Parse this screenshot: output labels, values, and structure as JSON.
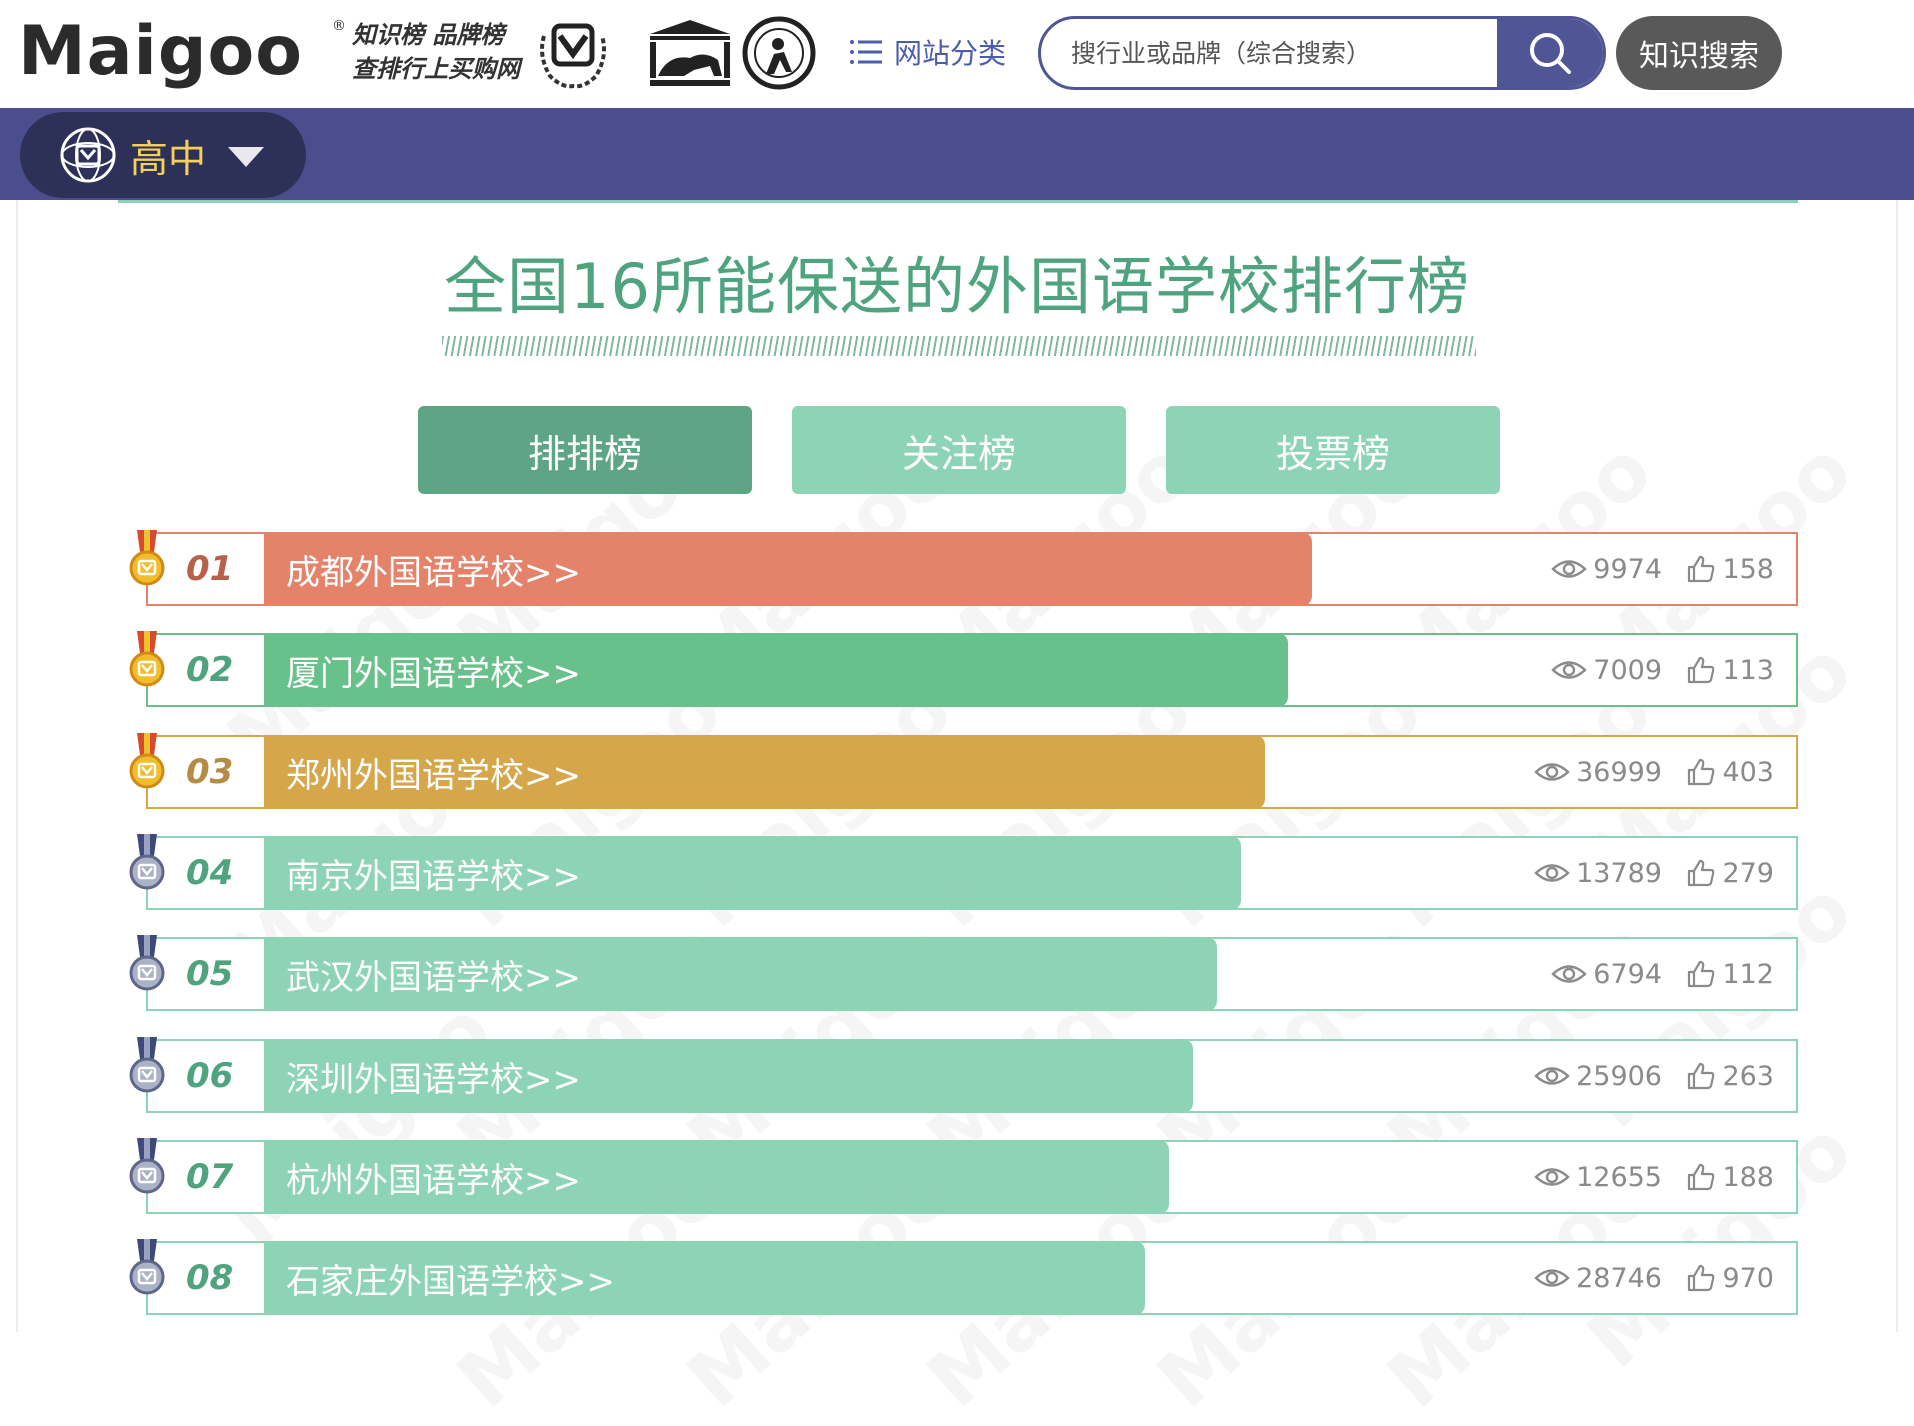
{
  "header": {
    "logo_text": "Maigoo",
    "logo_reg": "®",
    "slogan_line1": "知识榜 品牌榜",
    "slogan_line2": "查排行上买购网",
    "nav_category_label": "网站分类",
    "search_placeholder": "搜行业或品牌（综合搜索）",
    "knowledge_search_label": "知识搜索"
  },
  "category_bar": {
    "label": "高中"
  },
  "page": {
    "title": "全国16所能保送的外国语学校排行榜",
    "watermark_text": "Maigoo"
  },
  "tabs": [
    {
      "label": "排排榜",
      "active": true
    },
    {
      "label": "关注榜",
      "active": false
    },
    {
      "label": "投票榜",
      "active": false
    }
  ],
  "rows": [
    {
      "rank": "01",
      "name": "成都外国语学校>>",
      "views": "9974",
      "likes": "158",
      "color": "#e5826a",
      "rank_color": "#b8614a",
      "medal": "gold"
    },
    {
      "rank": "02",
      "name": "厦门外国语学校>>",
      "views": "7009",
      "likes": "113",
      "color": "#68c08a",
      "rank_color": "#4fa47f",
      "medal": "gold"
    },
    {
      "rank": "03",
      "name": "郑州外国语学校>>",
      "views": "36999",
      "likes": "403",
      "color": "#d5a64a",
      "rank_color": "#b48c46",
      "medal": "gold"
    },
    {
      "rank": "04",
      "name": "南京外国语学校>>",
      "views": "13789",
      "likes": "279",
      "color": "#8dd3b5",
      "rank_color": "#4fa47f",
      "medal": "silver"
    },
    {
      "rank": "05",
      "name": "武汉外国语学校>>",
      "views": "6794",
      "likes": "112",
      "color": "#8dd3b5",
      "rank_color": "#4fa47f",
      "medal": "silver"
    },
    {
      "rank": "06",
      "name": "深圳外国语学校>>",
      "views": "25906",
      "likes": "263",
      "color": "#8dd3b5",
      "rank_color": "#4fa47f",
      "medal": "silver"
    },
    {
      "rank": "07",
      "name": "杭州外国语学校>>",
      "views": "12655",
      "likes": "188",
      "color": "#8dd3b5",
      "rank_color": "#4fa47f",
      "medal": "silver"
    },
    {
      "rank": "08",
      "name": "石家庄外国语学校>>",
      "views": "28746",
      "likes": "970",
      "color": "#8dd3b5",
      "rank_color": "#4fa47f",
      "medal": "silver"
    }
  ],
  "colors": {
    "brand_purple": "#4b4e8c",
    "tab_active": "#5ea585",
    "tab_idle": "#8dd3b5",
    "title_green": "#4fa47f"
  },
  "icons": {
    "nav_category": "list-icon",
    "search": "search-icon",
    "category": "maigoo-emblem-icon",
    "views": "eye-icon",
    "likes": "thumbs-up-icon",
    "medal_gold": "gold-medal-icon",
    "medal_silver": "silver-medal-icon"
  }
}
